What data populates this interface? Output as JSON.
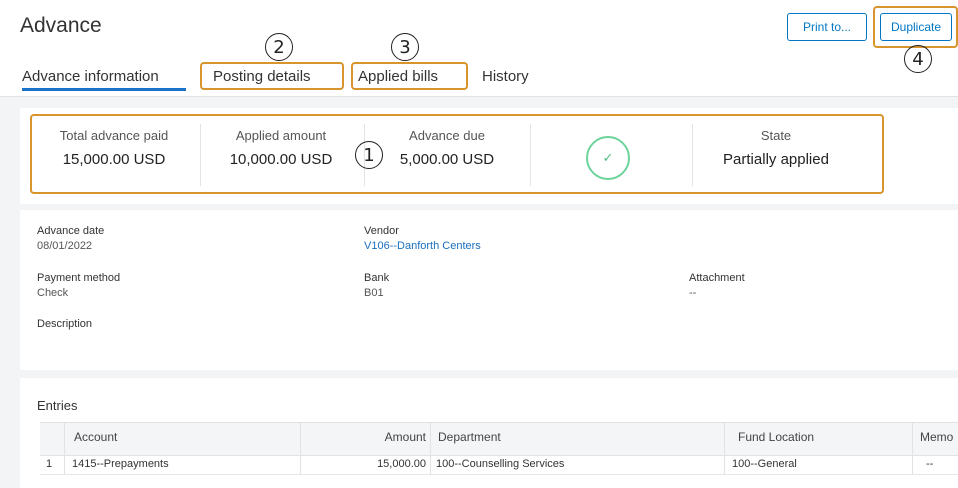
{
  "page": {
    "title": "Advance"
  },
  "toolbar": {
    "print_label": "Print to...",
    "duplicate_label": "Duplicate"
  },
  "tabs": [
    {
      "label": "Advance information",
      "active": true
    },
    {
      "label": "Posting details",
      "active": false
    },
    {
      "label": "Applied bills",
      "active": false
    },
    {
      "label": "History",
      "active": false
    }
  ],
  "callouts": [
    "1",
    "2",
    "3",
    "4"
  ],
  "summary": {
    "total_advance_paid": {
      "label": "Total advance paid",
      "value": "15,000.00 USD"
    },
    "applied_amount": {
      "label": "Applied amount",
      "value": "10,000.00 USD"
    },
    "advance_due": {
      "label": "Advance due",
      "value": "5,000.00 USD"
    },
    "state": {
      "label": "State",
      "value": "Partially applied"
    },
    "status_icon": "check-icon"
  },
  "details": {
    "advance_date": {
      "label": "Advance date",
      "value": "08/01/2022"
    },
    "vendor": {
      "label": "Vendor",
      "value": "V106--Danforth Centers"
    },
    "payment_method": {
      "label": "Payment method",
      "value": "Check"
    },
    "bank": {
      "label": "Bank",
      "value": "B01"
    },
    "attachment": {
      "label": "Attachment",
      "value": "--"
    },
    "description": {
      "label": "Description",
      "value": ""
    }
  },
  "entries": {
    "title": "Entries",
    "columns": [
      "Account",
      "Amount",
      "Department",
      "Fund Location",
      "Memo"
    ],
    "rows": [
      {
        "num": "1",
        "account": "1415--Prepayments",
        "amount": "15,000.00",
        "department": "100--Counselling Services",
        "fund_location": "100--General",
        "memo": "--"
      }
    ]
  },
  "colors": {
    "accent": "#0077c5",
    "callout": "#d8952e",
    "success": "#4fc37f"
  }
}
